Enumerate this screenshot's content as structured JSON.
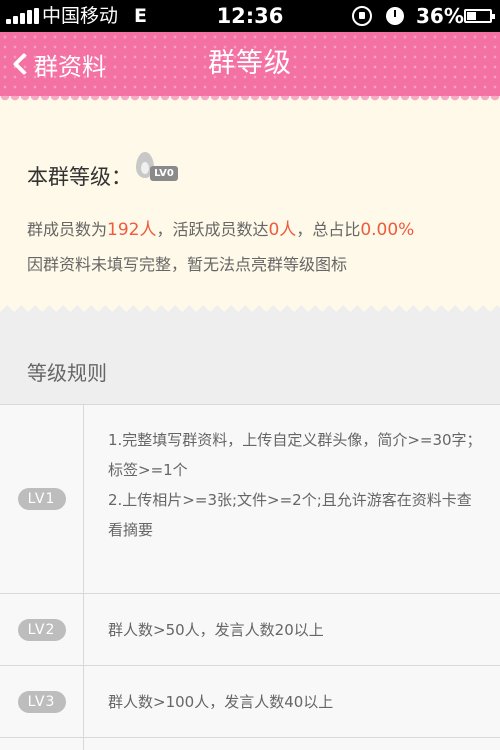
{
  "status_bar": {
    "carrier": "中国移动",
    "network": "E",
    "time": "12:36",
    "battery": "36%"
  },
  "header": {
    "back_label": "群资料",
    "title": "群等级"
  },
  "info": {
    "level_label": "本群等级：",
    "level_badge": "LV0",
    "stats_prefix": "群成员数为",
    "member_count": "192人",
    "stats_mid": "，活跃成员数达",
    "active_count": "0人",
    "stats_ratio_label": "，总占比",
    "ratio": "0.00%",
    "notice": "因群资料未填写完整，暂无法点亮群等级图标"
  },
  "rules": {
    "title": "等级规则",
    "rows": [
      {
        "level": "LV1",
        "lines": [
          "1.完整填写群资料，上传自定义群头像，简介>=30字；",
          "标签>=1个",
          "2.上传相片>=3张;文件>=2个;且允许游客在资料卡查",
          "看摘要"
        ]
      },
      {
        "level": "LV2",
        "lines": [
          "群人数>50人，发言人数20以上"
        ]
      },
      {
        "level": "LV3",
        "lines": [
          "群人数>100人，发言人数40以上"
        ]
      }
    ]
  },
  "colors": {
    "header_pink": "#f472a3",
    "highlight": "#f05a3c",
    "card_bg": "#fef9e8"
  }
}
